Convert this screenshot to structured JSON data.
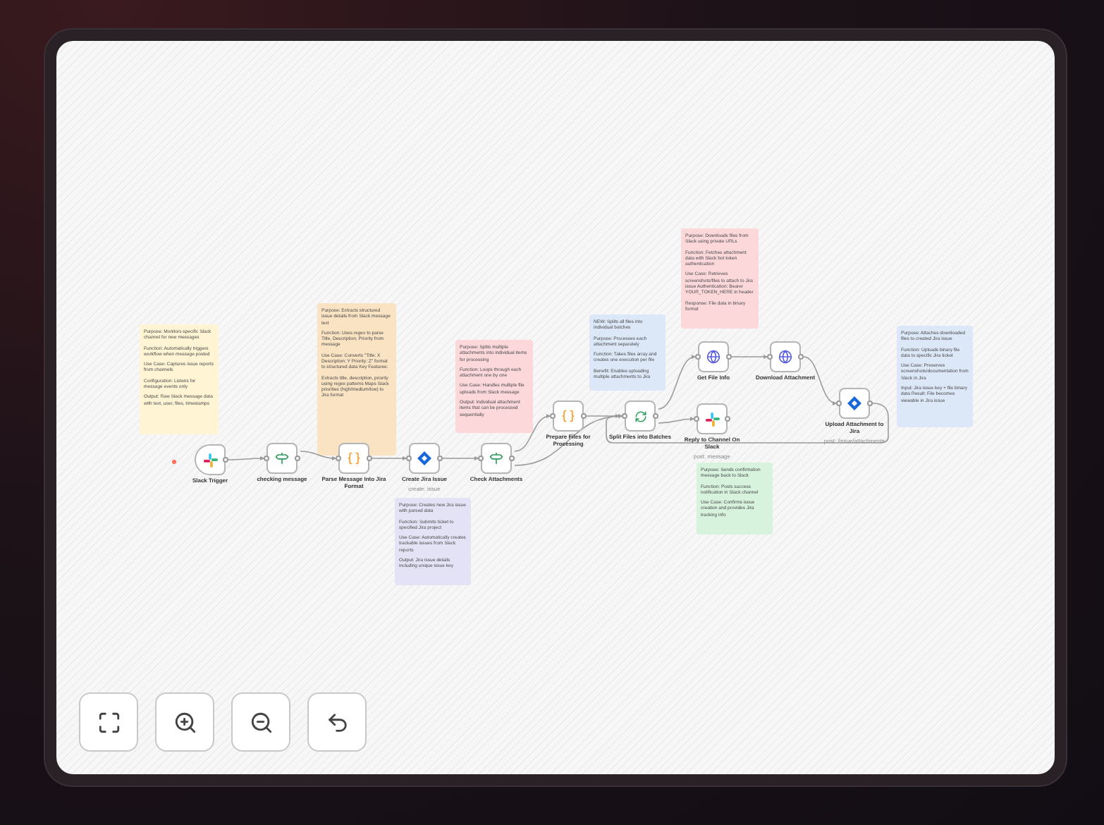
{
  "canvas": {
    "nodes": [
      {
        "kind": "slack",
        "trigger": true,
        "label": "Slack Trigger"
      },
      {
        "kind": "branch",
        "trigger": false,
        "label": "checking message"
      },
      {
        "kind": "code",
        "trigger": false,
        "label": "Parse Message Into Jira Format"
      },
      {
        "kind": "jira",
        "trigger": false,
        "label": "Create Jira Issue",
        "subtitle": "create: issue"
      },
      {
        "kind": "branch",
        "trigger": false,
        "label": "Check Attachments"
      },
      {
        "kind": "code",
        "trigger": false,
        "label": "Prepare Files for Processing"
      },
      {
        "kind": "loop",
        "trigger": false,
        "label": "Split Files into Batches"
      },
      {
        "kind": "globe",
        "trigger": false,
        "label": "Get File Info"
      },
      {
        "kind": "globe",
        "trigger": false,
        "label": "Download Attachment"
      },
      {
        "kind": "slack",
        "trigger": false,
        "label": "Reply to Channel On Slack",
        "subtitle": "post: message"
      },
      {
        "kind": "jira",
        "trigger": false,
        "label": "Upload Attachment to Jira",
        "subtitle": "post: /issue/attachments"
      }
    ],
    "notes": [
      {
        "color": "#fff4d4",
        "paragraphs": [
          "Purpose: Monitors specific Slack channel for new messages",
          "Function: Automatically triggers workflow when message posted",
          "Use Case: Captures issue reports from channels",
          "Configuration: Listens for message events only",
          "Output: Raw Slack message data with text, user, files, timestamps"
        ]
      },
      {
        "color": "#fae3c3",
        "paragraphs": [
          "Purpose: Extracts structured issue details from Slack message text",
          "Function: Uses regex to parse Title, Description, Priority from message",
          "Use Case: Converts \"Title: X Description: Y Priority: Z\" format to structured data Key Features:",
          "Extracts title, description, priority using regex patterns Maps Slack priorities (high/medium/low) to Jira format"
        ]
      },
      {
        "color": "#fcd8da",
        "paragraphs": [
          "Purpose: Splits multiple attachments into individual items for processing",
          "Function: Loops through each attachment one by one",
          "Use Case: Handles multiple file uploads from Slack message",
          "Output: Individual attachment items that can be processed sequentially"
        ]
      },
      {
        "color": "#e4e3f6",
        "paragraphs": [
          "Purpose: Creates new Jira issue with parsed data",
          "Function: Submits ticket to specified Jira project",
          "Use Case: Automatically creates trackable issues from Slack reports",
          "Output: Jira issue details including unique issue key"
        ]
      },
      {
        "color": "#dce8f8",
        "paragraphs": [
          "NEW: Splits all files into individual batches",
          "Purpose: Processes each attachment separately",
          "Function: Takes files array and creates one execution per file",
          "Benefit: Enables uploading multiple attachments to Jira"
        ]
      },
      {
        "color": "#fcd8da",
        "paragraphs": [
          "Purpose: Downloads files from Slack using private URLs",
          "Function: Fetches attachment data with Slack bot token authentication",
          "Use Case: Retrieves screenshots/files to attach to Jira issue Authentication: Bearer YOUR_TOKEN_HERE in header",
          "Response: File data in binary format"
        ]
      },
      {
        "color": "#d7f2dd",
        "paragraphs": [
          "Purpose: Sends confirmation message back to Slack",
          "Function: Posts success notification in Slack channel",
          "Use Case: Confirms issue creation and provides Jira tracking info"
        ]
      },
      {
        "color": "#dce8f8",
        "paragraphs": [
          "Purpose: Attaches downloaded files to created Jira issue",
          "Function: Uploads binary file data to specific Jira ticket",
          "Use Case: Preserves screenshots/documentation from Slack in Jira",
          "Input: Jira issue key + file binary data Result: File becomes viewable in Jira issue"
        ]
      }
    ]
  },
  "controls": [
    {
      "kind": "fit"
    },
    {
      "kind": "zoom-in"
    },
    {
      "kind": "zoom-out"
    },
    {
      "kind": "undo"
    }
  ]
}
